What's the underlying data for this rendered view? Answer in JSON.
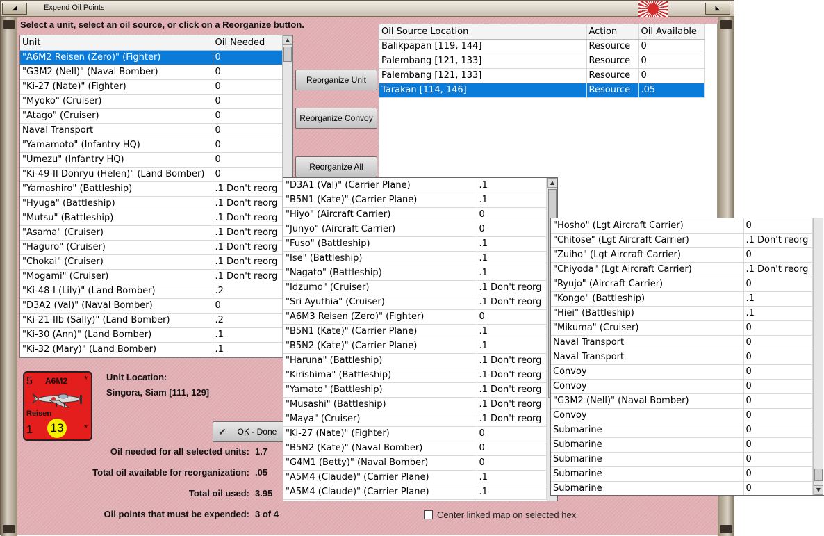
{
  "window": {
    "title": "Expend Oil Points"
  },
  "instruction": "Select a unit, select an oil source, or click on a Reorganize button.",
  "units_table": {
    "headers": [
      "Unit",
      "Oil Needed"
    ],
    "rows": [
      [
        "\"A6M2 Reisen (Zero)\" (Fighter)",
        "0"
      ],
      [
        "\"G3M2 (Nell)\" (Naval Bomber)",
        "0"
      ],
      [
        "\"Ki-27 (Nate)\" (Fighter)",
        "0"
      ],
      [
        "\"Myoko\" (Cruiser)",
        "0"
      ],
      [
        "\"Atago\" (Cruiser)",
        "0"
      ],
      [
        "Naval Transport",
        "0"
      ],
      [
        "\"Yamamoto\" (Infantry HQ)",
        "0"
      ],
      [
        "\"Umezu\" (Infantry HQ)",
        "0"
      ],
      [
        "\"Ki-49-II Donryu (Helen)\" (Land Bomber)",
        "0"
      ],
      [
        "\"Yamashiro\" (Battleship)",
        ".1 Don't reorg"
      ],
      [
        "\"Hyuga\" (Battleship)",
        ".1 Don't reorg"
      ],
      [
        "\"Mutsu\" (Battleship)",
        ".1 Don't reorg"
      ],
      [
        "\"Asama\" (Cruiser)",
        ".1 Don't reorg"
      ],
      [
        "\"Haguro\" (Cruiser)",
        ".1 Don't reorg"
      ],
      [
        "\"Chokai\" (Cruiser)",
        ".1 Don't reorg"
      ],
      [
        "\"Mogami\" (Cruiser)",
        ".1 Don't reorg"
      ],
      [
        "\"Ki-48-I (Lily)\" (Land Bomber)",
        ".2"
      ],
      [
        "\"D3A2 (Val)\" (Naval Bomber)",
        "0"
      ],
      [
        "\"Ki-21-IIb (Sally)\" (Land Bomber)",
        ".2"
      ],
      [
        "\"Ki-30 (Ann)\" (Land Bomber)",
        ".1"
      ],
      [
        "\"Ki-32 (Mary)\" (Land Bomber)",
        ".1"
      ]
    ]
  },
  "buttons": {
    "reorganize_unit": "Reorganize Unit",
    "reorganize_convoy": "Reorganize Convoy",
    "reorganize_all": "Reorganize All",
    "ok_done": "OK - Done"
  },
  "sources_table": {
    "headers": [
      "Oil Source Location",
      "Action",
      "Oil Available"
    ],
    "rows": [
      [
        "Balikpapan [119, 144]",
        "Resource",
        "0"
      ],
      [
        "Palembang [121, 133]",
        "Resource",
        "0"
      ],
      [
        "Palembang [121, 133]",
        "Resource",
        "0"
      ],
      [
        "Tarakan [114, 146]",
        "Resource",
        ".05"
      ]
    ]
  },
  "continuation_list_1": [
    [
      "\"D3A1 (Val)\" (Carrier Plane)",
      ".1"
    ],
    [
      "\"B5N1 (Kate)\" (Carrier Plane)",
      ".1"
    ],
    [
      "\"Hiyo\" (Aircraft Carrier)",
      "0"
    ],
    [
      "\"Junyo\" (Aircraft Carrier)",
      "0"
    ],
    [
      "\"Fuso\" (Battleship)",
      ".1"
    ],
    [
      "\"Ise\" (Battleship)",
      ".1"
    ],
    [
      "\"Nagato\" (Battleship)",
      ".1"
    ],
    [
      "\"Idzumo\" (Cruiser)",
      ".1 Don't reorg"
    ],
    [
      "\"Sri Ayuthia\" (Cruiser)",
      ".1 Don't reorg"
    ],
    [
      "\"A6M3 Reisen (Zero)\" (Fighter)",
      "0"
    ],
    [
      "\"B5N1 (Kate)\" (Carrier Plane)",
      ".1"
    ],
    [
      "\"B5N2 (Kate)\" (Carrier Plane)",
      ".1"
    ],
    [
      "\"Haruna\" (Battleship)",
      ".1 Don't reorg"
    ],
    [
      "\"Kirishima\" (Battleship)",
      ".1 Don't reorg"
    ],
    [
      "\"Yamato\" (Battleship)",
      ".1 Don't reorg"
    ],
    [
      "\"Musashi\" (Battleship)",
      ".1 Don't reorg"
    ],
    [
      "\"Maya\" (Cruiser)",
      ".1 Don't reorg"
    ],
    [
      "\"Ki-27 (Nate)\" (Fighter)",
      "0"
    ],
    [
      "\"B5N2 (Kate)\" (Naval Bomber)",
      "0"
    ],
    [
      "\"G4M1 (Betty)\" (Naval Bomber)",
      "0"
    ],
    [
      "\"A5M4 (Claude)\" (Carrier Plane)",
      ".1"
    ],
    [
      "\"A5M4 (Claude)\" (Carrier Plane)",
      ".1"
    ]
  ],
  "continuation_list_2": [
    [
      "\"Hosho\" (Lgt Aircraft Carrier)",
      "0"
    ],
    [
      "\"Chitose\" (Lgt Aircraft Carrier)",
      ".1 Don't reorg"
    ],
    [
      "\"Zuiho\" (Lgt Aircraft Carrier)",
      "0"
    ],
    [
      "\"Chiyoda\" (Lgt Aircraft Carrier)",
      ".1 Don't reorg"
    ],
    [
      "\"Ryujo\" (Aircraft Carrier)",
      "0"
    ],
    [
      "\"Kongo\" (Battleship)",
      ".1"
    ],
    [
      "\"Hiei\" (Battleship)",
      ".1"
    ],
    [
      "\"Mikuma\" (Cruiser)",
      "0"
    ],
    [
      "Naval Transport",
      "0"
    ],
    [
      "Naval Transport",
      "0"
    ],
    [
      "Convoy",
      "0"
    ],
    [
      "Convoy",
      "0"
    ],
    [
      "\"G3M2 (Nell)\" (Naval Bomber)",
      "0"
    ],
    [
      "Convoy",
      "0"
    ],
    [
      "Submarine",
      "0"
    ],
    [
      "Submarine",
      "0"
    ],
    [
      "Submarine",
      "0"
    ],
    [
      "Submarine",
      "0"
    ],
    [
      "Submarine",
      "0"
    ]
  ],
  "counter": {
    "model": "A6M2",
    "name": "Reisen",
    "attack": "5",
    "defense": "1",
    "movement": "13",
    "star_top": "*",
    "star_bottom": "*"
  },
  "unit_location": {
    "label": "Unit Location:",
    "value": "Singora, Siam [111, 129]"
  },
  "summary": {
    "oil_needed_label": "Oil needed for all selected units:",
    "oil_needed_value": "1.7",
    "total_available_label": "Total oil available for reorganization:",
    "total_available_value": ".05",
    "total_used_label": "Total oil used:",
    "total_used_value": "3.95",
    "must_expend_label": "Oil points that must be expended:",
    "must_expend_value": "3 of 4"
  },
  "center_map_checkbox": {
    "label": "Center linked map on selected hex",
    "checked": false
  },
  "colors": {
    "background_pink": "#e2b0b4",
    "selection_blue": "#0a7bd9",
    "counter_red": "#e41d1d",
    "counter_yellow": "#f5f000"
  }
}
